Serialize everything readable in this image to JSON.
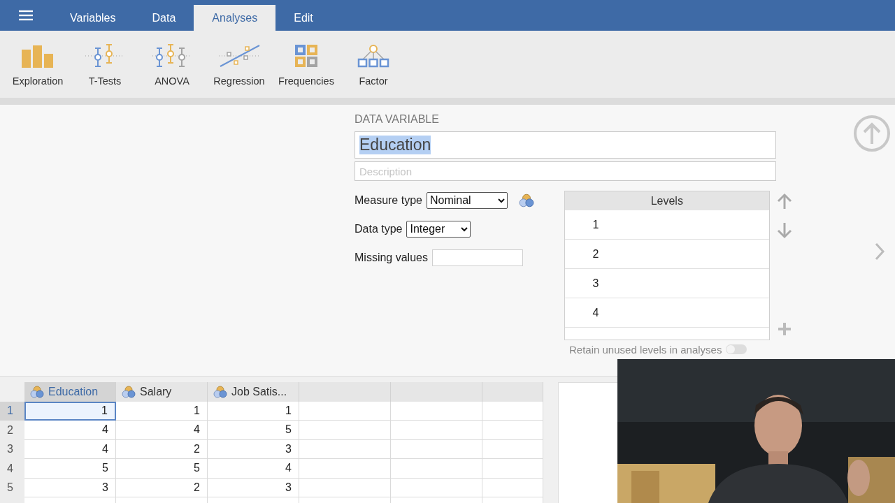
{
  "menu_tabs": [
    {
      "label": "Variables",
      "selected": false
    },
    {
      "label": "Data",
      "selected": false
    },
    {
      "label": "Analyses",
      "selected": true
    },
    {
      "label": "Edit",
      "selected": false
    }
  ],
  "ribbon": [
    {
      "label": "Exploration",
      "kind": "exploration"
    },
    {
      "label": "T-Tests",
      "kind": "ttests"
    },
    {
      "label": "ANOVA",
      "kind": "anova"
    },
    {
      "label": "Regression",
      "kind": "regression"
    },
    {
      "label": "Frequencies",
      "kind": "frequencies"
    },
    {
      "label": "Factor",
      "kind": "factor"
    }
  ],
  "variable_panel": {
    "heading": "DATA VARIABLE",
    "name": "Education",
    "name_highlighted": true,
    "description_placeholder": "Description",
    "measure_type": {
      "label": "Measure type",
      "value": "Nominal"
    },
    "data_type": {
      "label": "Data type",
      "value": "Integer"
    },
    "missing_values": {
      "label": "Missing values"
    },
    "levels": {
      "heading": "Levels",
      "items": [
        "1",
        "2",
        "3",
        "4"
      ]
    },
    "retain_unused": {
      "label": "Retain unused levels in analyses",
      "on": false
    }
  },
  "grid": {
    "columns": [
      {
        "name": "Education",
        "selected": true
      },
      {
        "name": "Salary",
        "selected": false
      },
      {
        "name": "Job Satis...",
        "selected": false
      }
    ],
    "rows": [
      {
        "number": "1",
        "selected": true,
        "cells": [
          "1",
          "1",
          "1"
        ]
      },
      {
        "number": "2",
        "selected": false,
        "cells": [
          "4",
          "4",
          "5"
        ]
      },
      {
        "number": "3",
        "selected": false,
        "cells": [
          "4",
          "2",
          "3"
        ]
      },
      {
        "number": "4",
        "selected": false,
        "cells": [
          "5",
          "5",
          "4"
        ]
      },
      {
        "number": "5",
        "selected": false,
        "cells": [
          "3",
          "2",
          "3"
        ]
      }
    ]
  }
}
